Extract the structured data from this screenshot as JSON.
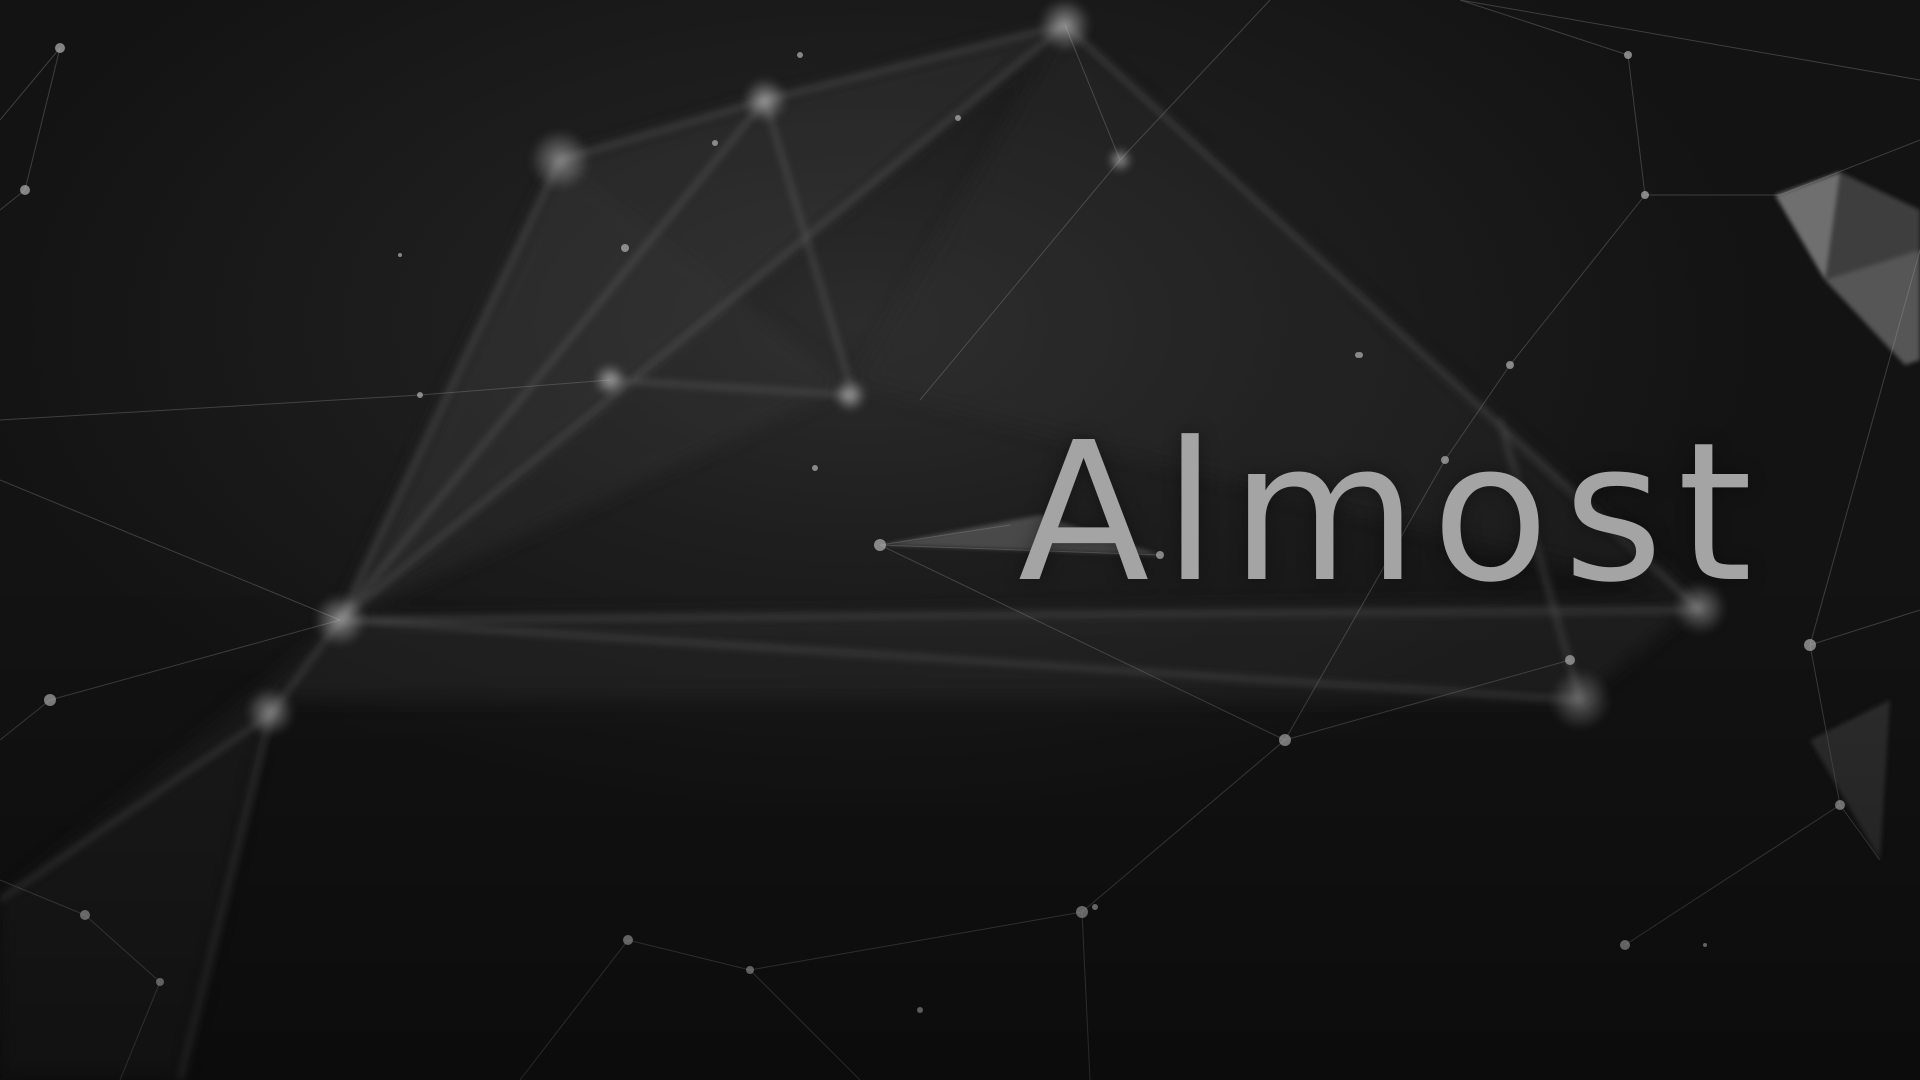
{
  "screen": {
    "headline": "Almost"
  },
  "background": {
    "description_icon": "network-plexus-icon",
    "colors": {
      "base": "#141414",
      "glow": "#2c2c2c",
      "line": "#9a9a9a",
      "node": "#bdbdbd",
      "text": "#a4a4a4"
    }
  }
}
